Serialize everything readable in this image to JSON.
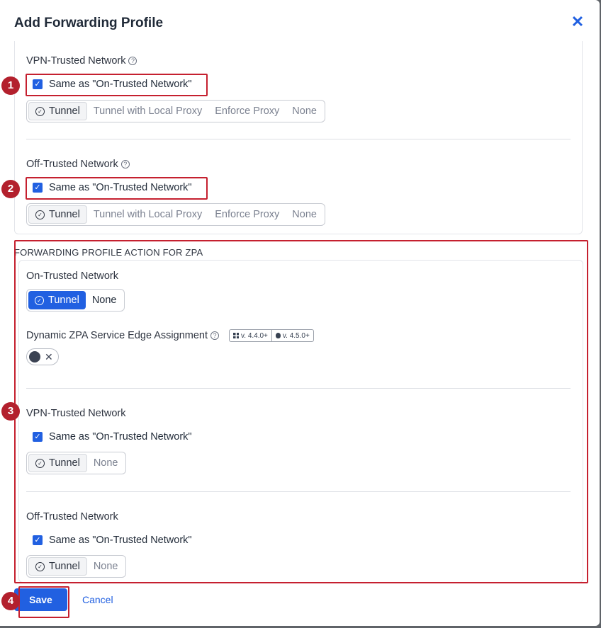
{
  "dialog": {
    "title": "Add Forwarding Profile",
    "close_icon": "close-icon"
  },
  "zia": {
    "vpn_trusted": {
      "label": "VPN-Trusted Network",
      "same_as_label": "Same as \"On-Trusted Network\"",
      "same_as_checked": true,
      "options": [
        "Tunnel",
        "Tunnel with Local Proxy",
        "Enforce Proxy",
        "None"
      ],
      "selected": "Tunnel"
    },
    "off_trusted": {
      "label": "Off-Trusted Network",
      "same_as_label": "Same as \"On-Trusted Network\"",
      "same_as_checked": true,
      "options": [
        "Tunnel",
        "Tunnel with Local Proxy",
        "Enforce Proxy",
        "None"
      ],
      "selected": "Tunnel"
    }
  },
  "zpa": {
    "section_title": "FORWARDING PROFILE ACTION FOR ZPA",
    "on_trusted": {
      "label": "On-Trusted Network",
      "options": [
        "Tunnel",
        "None"
      ],
      "selected": "Tunnel"
    },
    "dynamic_assignment": {
      "label": "Dynamic ZPA Service Edge Assignment",
      "windows_version": "v. 4.4.0+",
      "mac_version": "v. 4.5.0+",
      "enabled": false,
      "toggle_off_glyph": "✕"
    },
    "vpn_trusted": {
      "label": "VPN-Trusted Network",
      "same_as_label": "Same as \"On-Trusted Network\"",
      "same_as_checked": true,
      "options": [
        "Tunnel",
        "None"
      ],
      "selected": "Tunnel"
    },
    "off_trusted": {
      "label": "Off-Trusted Network",
      "same_as_label": "Same as \"On-Trusted Network\"",
      "same_as_checked": true,
      "options": [
        "Tunnel",
        "None"
      ],
      "selected": "Tunnel"
    }
  },
  "footer": {
    "save_label": "Save",
    "cancel_label": "Cancel"
  },
  "annotations": {
    "markers": [
      "1",
      "2",
      "3",
      "4"
    ],
    "color": "#b3202d"
  },
  "colors": {
    "accent": "#2160e1",
    "annotation_red": "#c5202f"
  }
}
